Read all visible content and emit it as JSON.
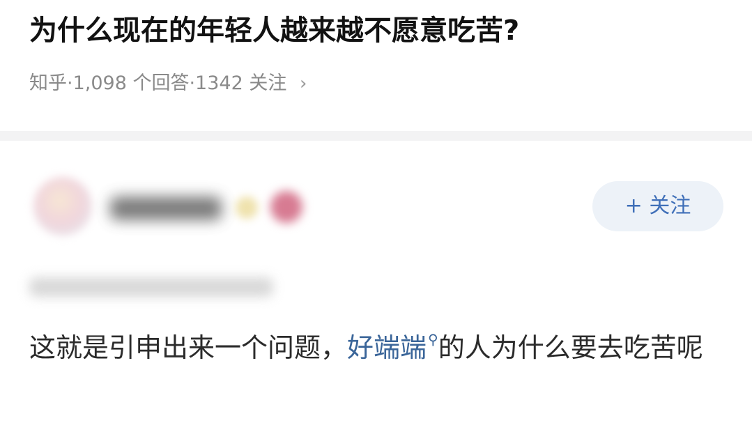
{
  "question": {
    "title": "为什么现在的年轻人越来越不愿意吃苦?",
    "meta": "知乎·1,098 个回答·1342 关注",
    "chevron": "›"
  },
  "answer": {
    "follow_label": "+ 关注",
    "body_before_keyword": "这就是引申出来一个问题，",
    "keyword": "好端端",
    "search_icon": "⚲",
    "body_after_keyword": "的人为什么要去吃苦呢"
  }
}
